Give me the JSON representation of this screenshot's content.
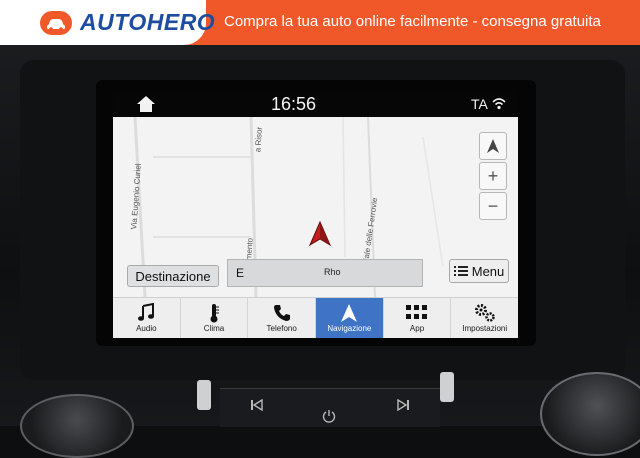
{
  "banner": {
    "logo_text": "AUTOHERO",
    "tagline": "Compra la tua auto online facilmente - consegna gratuita",
    "colors": {
      "banner": "#f0582a",
      "logo": "#1c4da1"
    }
  },
  "statusbar": {
    "time": "16:56",
    "ta": "TA",
    "icons": [
      "home-icon",
      "wifi-icon"
    ]
  },
  "map": {
    "streets": [
      "Via Eugenio Curiel",
      "Via Risorgimento",
      "Viale delle Ferrovie"
    ],
    "street_fragment": "a Risor",
    "street_fragment2": "Risorgimento",
    "controls": {
      "north": "▲",
      "zoom_in": "+",
      "zoom_out": "−"
    }
  },
  "search": {
    "destination_label": "Destinazione",
    "field_prefix": "E",
    "field_text": "Rho",
    "menu_label": "Menu"
  },
  "nav": {
    "items": [
      {
        "label": "Audio",
        "icon": "music-note-icon"
      },
      {
        "label": "Clima",
        "icon": "thermometer-icon"
      },
      {
        "label": "Telefono",
        "icon": "phone-icon"
      },
      {
        "label": "Navigazione",
        "icon": "navigation-arrow-icon",
        "active": true
      },
      {
        "label": "App",
        "icon": "app-grid-icon"
      },
      {
        "label": "Impostazioni",
        "icon": "gears-icon"
      }
    ],
    "active_color": "#3f73c6"
  },
  "console": {
    "icons": [
      "skip-back-icon",
      "power-icon",
      "skip-forward-icon"
    ]
  }
}
